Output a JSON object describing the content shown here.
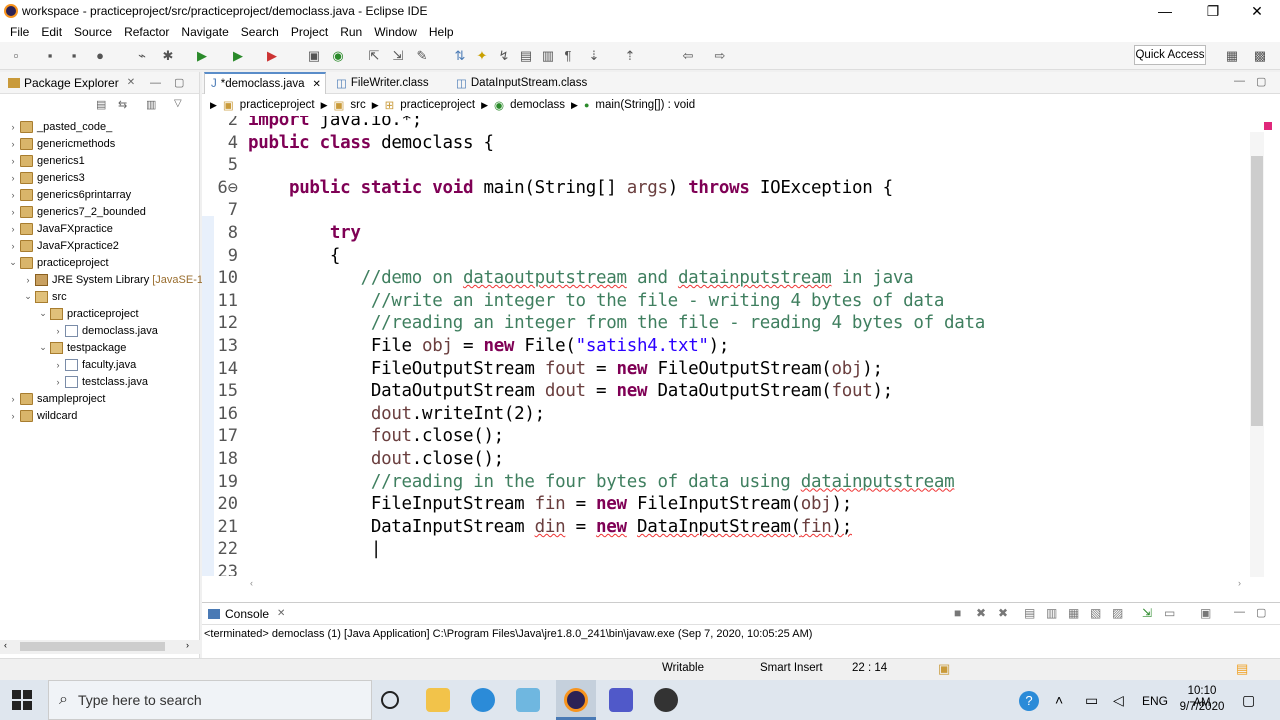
{
  "window": {
    "title": "workspace - practiceproject/src/practiceproject/democlass.java - Eclipse IDE"
  },
  "menu": [
    "File",
    "Edit",
    "Source",
    "Refactor",
    "Navigate",
    "Search",
    "Project",
    "Run",
    "Window",
    "Help"
  ],
  "toolbar": {
    "quick_access": "Quick Access"
  },
  "package_explorer": {
    "title": "Package Explorer",
    "items": [
      {
        "label": "_pasted_code_",
        "type": "proj",
        "depth": 0,
        "twisty": "›"
      },
      {
        "label": "genericmethods",
        "type": "proj",
        "depth": 0,
        "twisty": "›"
      },
      {
        "label": "generics1",
        "type": "proj",
        "depth": 0,
        "twisty": "›"
      },
      {
        "label": "generics3",
        "type": "proj",
        "depth": 0,
        "twisty": "›"
      },
      {
        "label": "generics6printarray",
        "type": "proj",
        "depth": 0,
        "twisty": "›"
      },
      {
        "label": "generics7_2_bounded",
        "type": "proj",
        "depth": 0,
        "twisty": "›"
      },
      {
        "label": "JavaFXpractice",
        "type": "proj",
        "depth": 0,
        "twisty": "›"
      },
      {
        "label": "JavaFXpractice2",
        "type": "proj",
        "depth": 0,
        "twisty": "›"
      },
      {
        "label": "practiceproject",
        "type": "proj",
        "depth": 0,
        "twisty": "⌄"
      },
      {
        "label": "JRE System Library [JavaSE-1",
        "type": "lib",
        "depth": 1,
        "twisty": "›"
      },
      {
        "label": "src",
        "type": "pkg",
        "depth": 1,
        "twisty": "⌄"
      },
      {
        "label": "practiceproject",
        "type": "pkg",
        "depth": 2,
        "twisty": "⌄"
      },
      {
        "label": "democlass.java",
        "type": "jfile",
        "depth": 3,
        "twisty": "›"
      },
      {
        "label": "testpackage",
        "type": "pkg",
        "depth": 2,
        "twisty": "⌄"
      },
      {
        "label": "faculty.java",
        "type": "jfile",
        "depth": 3,
        "twisty": "›"
      },
      {
        "label": "testclass.java",
        "type": "jfile",
        "depth": 3,
        "twisty": "›"
      },
      {
        "label": "sampleproject",
        "type": "proj",
        "depth": 0,
        "twisty": "›"
      },
      {
        "label": "wildcard",
        "type": "proj",
        "depth": 0,
        "twisty": "›"
      }
    ]
  },
  "editor": {
    "tabs": [
      "*democlass.java",
      "FileWriter.class",
      "DataInputStream.class"
    ],
    "breadcrumb": [
      "practiceproject",
      "src",
      "practiceproject",
      "democlass",
      "main(String[]) : void"
    ],
    "lines": [
      {
        "n": "2",
        "html": "<span class='kw'>import</span> java.io.*;"
      },
      {
        "n": "4",
        "html": "<span class='kw'>public class</span> democlass {"
      },
      {
        "n": "5",
        "html": ""
      },
      {
        "n": "6⊖",
        "html": "    <span class='kw'>public static void</span> main(String[] <span class='var'>args</span>) <span class='kw'>throws</span> IOException {"
      },
      {
        "n": "7",
        "html": ""
      },
      {
        "n": "8",
        "html": "        <span class='kw'>try</span>"
      },
      {
        "n": "9",
        "html": "        {"
      },
      {
        "n": "10",
        "html": "           <span class='cm'>//demo on <span class='sq'>dataoutputstream</span> and <span class='sq'>datainputstream</span> in java</span>"
      },
      {
        "n": "11",
        "html": "            <span class='cm'>//write an integer to the file - writing 4 bytes of data</span>"
      },
      {
        "n": "12",
        "html": "            <span class='cm'>//reading an integer from the file - reading 4 bytes of data</span>"
      },
      {
        "n": "13",
        "html": "            File <span class='var'>obj</span> = <span class='kw'>new</span> File(<span class='st'>\"satish4.txt\"</span>);"
      },
      {
        "n": "14",
        "html": "            FileOutputStream <span class='var'>fout</span> = <span class='kw'>new</span> FileOutputStream(<span class='var'>obj</span>);"
      },
      {
        "n": "15",
        "html": "            DataOutputStream <span class='var'>dout</span> = <span class='kw'>new</span> DataOutputStream(<span class='var'>fout</span>);"
      },
      {
        "n": "16",
        "html": "            <span class='var'>dout</span>.writeInt(2);"
      },
      {
        "n": "17",
        "html": "            <span class='var'>fout</span>.close();"
      },
      {
        "n": "18",
        "html": "            <span class='var'>dout</span>.close();"
      },
      {
        "n": "19",
        "html": "            <span class='cm'>//reading in the four bytes of data using <span class='sq'>datainputstream</span></span>"
      },
      {
        "n": "20",
        "html": "            FileInputStream <span class='var'>fin</span> = <span class='kw'>new</span> FileInputStream(<span class='var'>obj</span>);"
      },
      {
        "n": "21",
        "html": "            DataInputStream <span class='var sq'>din</span> = <span class='kw sq'>new</span> <span class='sq'>DataInputStream(<span class='var'>fin</span>);</span>"
      },
      {
        "n": "22",
        "html": "            |"
      },
      {
        "n": "23",
        "html": ""
      }
    ]
  },
  "console": {
    "title": "Console",
    "status": "<terminated> democlass (1) [Java Application] C:\\Program Files\\Java\\jre1.8.0_241\\bin\\javaw.exe (Sep 7, 2020, 10:05:25 AM)"
  },
  "status": {
    "writable": "Writable",
    "insert": "Smart Insert",
    "position": "22 : 14"
  },
  "taskbar": {
    "search_placeholder": "Type here to search",
    "lang": "ENG",
    "time": "10:10 AM",
    "date": "9/7/2020"
  }
}
